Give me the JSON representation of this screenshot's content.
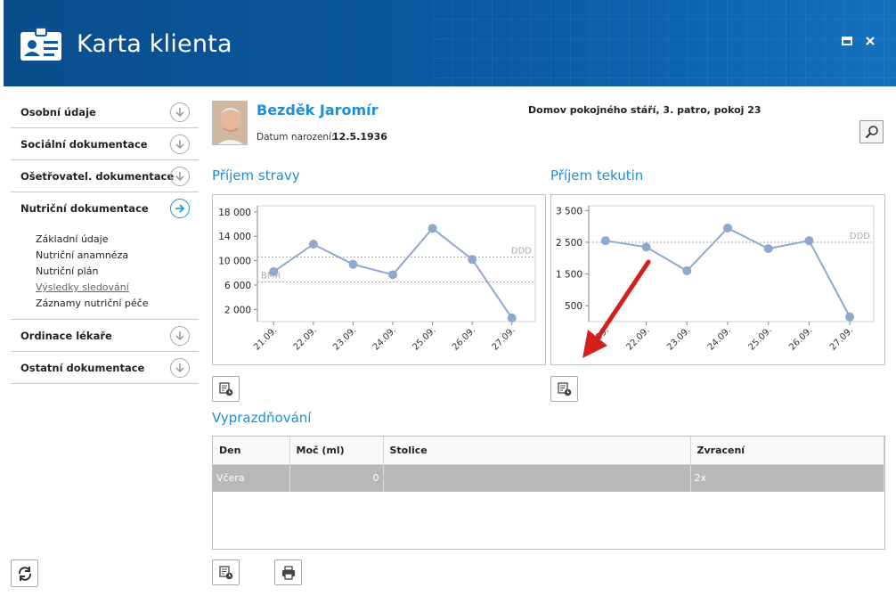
{
  "window": {
    "title": "Karta klienta",
    "buttons": {
      "maximize": "▪",
      "close": "✕"
    }
  },
  "sidebar": {
    "sections": [
      {
        "label": "Osobní údaje"
      },
      {
        "label": "Sociální dokumentace"
      },
      {
        "label": "Ošetřovatel. dokumentace"
      },
      {
        "label": "Nutriční dokumentace"
      },
      {
        "label": "Ordinace lékaře"
      },
      {
        "label": "Ostatní dokumentace"
      }
    ],
    "active_section": "Nutriční dokumentace",
    "sub_items": [
      {
        "label": "Základní údaje"
      },
      {
        "label": "Nutriční anamnéza"
      },
      {
        "label": "Nutriční plán"
      },
      {
        "label": "Výsledky sledování"
      },
      {
        "label": "Záznamy nutriční péče"
      }
    ],
    "icons": {
      "collapsed": "chevron-down-icon",
      "expanded": "arrow-right-icon"
    }
  },
  "client": {
    "name": "Bezděk Jaromír",
    "dob_label": "Datum narození:",
    "dob": "12.5.1936",
    "location": "Domov pokojného stáří, 3. patro, pokoj 23"
  },
  "sections": {
    "food": "Příjem stravy",
    "fluids": "Příjem tekutin",
    "excretion": "Vyprazdňování"
  },
  "chart_data": [
    {
      "type": "line",
      "title": "Příjem stravy",
      "categories": [
        "21.09.",
        "22.09.",
        "23.09.",
        "24.09.",
        "25.09.",
        "26.09.",
        "27.09."
      ],
      "values": [
        8200,
        12700,
        9400,
        7700,
        15300,
        10200,
        600
      ],
      "yticks": [
        "18 000",
        "14 000",
        "10 000",
        "6 000",
        "2 000"
      ],
      "ytick_values": [
        18000,
        14000,
        10000,
        6000,
        2000
      ],
      "ylim": [
        0,
        19000
      ],
      "reference_lines": [
        {
          "label": "DDD",
          "value": 10600
        },
        {
          "label": "BMR",
          "value": 6500
        }
      ],
      "color": "#8ea9cb"
    },
    {
      "type": "line",
      "title": "Příjem tekutin",
      "categories": [
        "21.09.",
        "22.09.",
        "23.09.",
        "24.09.",
        "25.09.",
        "26.09.",
        "27.09."
      ],
      "values": [
        2550,
        2350,
        1600,
        2950,
        2300,
        2550,
        150
      ],
      "yticks": [
        "3 500",
        "2 500",
        "1 500",
        "500"
      ],
      "ytick_values": [
        3500,
        2500,
        1500,
        500
      ],
      "ylim": [
        0,
        3650
      ],
      "reference_lines": [
        {
          "label": "DDD",
          "value": 2500
        }
      ],
      "color": "#8ea9cb"
    }
  ],
  "table": {
    "columns": [
      "Den",
      "Moč (ml)",
      "Stolice",
      "Zvracení"
    ],
    "rows": [
      {
        "den": "Včera",
        "moc": "0",
        "stolice": "",
        "zvraceni": "2x"
      }
    ]
  },
  "annotation": {
    "color": "#d41f1f"
  }
}
